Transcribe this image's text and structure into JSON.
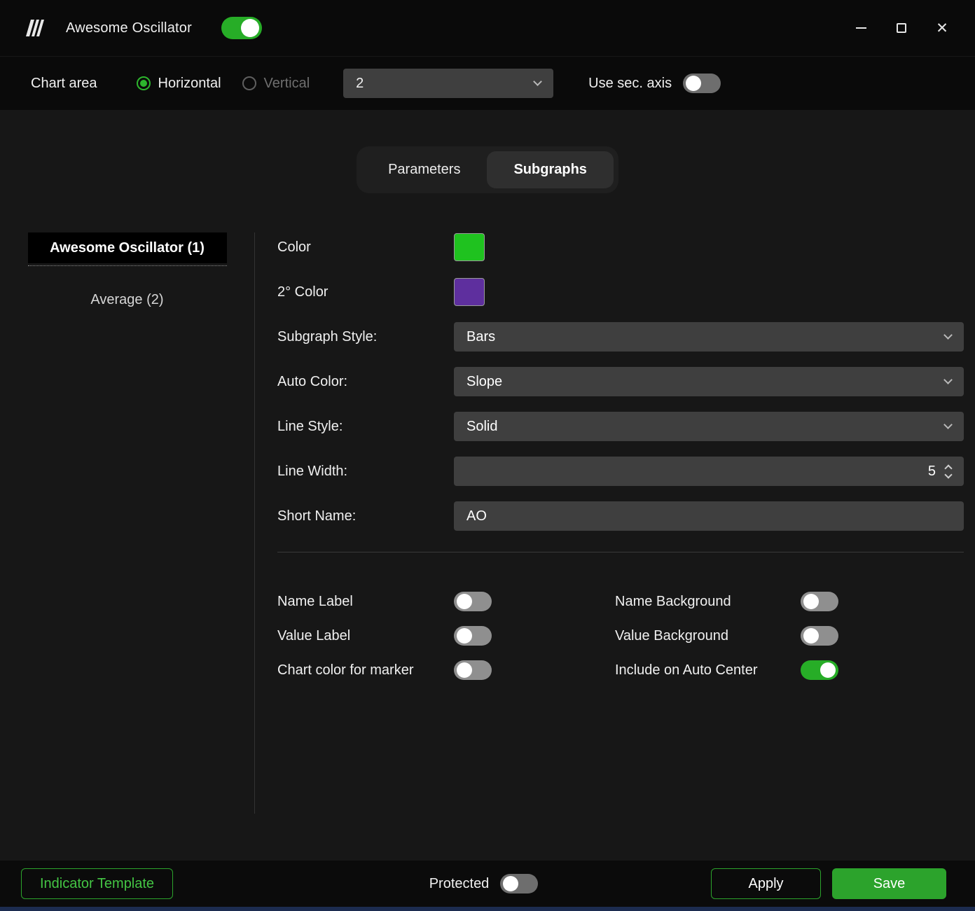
{
  "window": {
    "title": "Awesome Oscillator",
    "enabled": true,
    "close_glyph": "✕"
  },
  "chart_area": {
    "label": "Chart area",
    "options": [
      {
        "label": "Horizontal",
        "selected": true
      },
      {
        "label": "Vertical",
        "selected": false
      }
    ],
    "area_value": "2",
    "sec_axis_label": "Use sec. axis",
    "sec_axis_on": false
  },
  "tabs": [
    {
      "label": "Parameters",
      "active": false
    },
    {
      "label": "Subgraphs",
      "active": true
    }
  ],
  "subgraphs": [
    {
      "label": "Awesome Oscillator (1)",
      "selected": true
    },
    {
      "label": "Average (2)",
      "selected": false
    }
  ],
  "form": {
    "color": {
      "label": "Color",
      "value": "#1fc21f"
    },
    "secondary_color": {
      "label": "2° Color",
      "value": "#5e2f9e"
    },
    "subgraph_style": {
      "label": "Subgraph Style:",
      "value": "Bars"
    },
    "auto_color": {
      "label": "Auto Color:",
      "value": "Slope"
    },
    "line_style": {
      "label": "Line Style:",
      "value": "Solid"
    },
    "line_width": {
      "label": "Line Width:",
      "value": "5"
    },
    "short_name": {
      "label": "Short Name:",
      "value": "AO"
    }
  },
  "display_toggles": {
    "name_label": {
      "label": "Name Label",
      "on": false
    },
    "value_label": {
      "label": "Value Label",
      "on": false
    },
    "chart_color_for_marker": {
      "label": "Chart color for marker",
      "on": false
    },
    "name_background": {
      "label": "Name Background",
      "on": false
    },
    "value_background": {
      "label": "Value Background",
      "on": false
    },
    "include_on_auto_center": {
      "label": "Include on Auto Center",
      "on": true
    }
  },
  "footer": {
    "indicator_template": "Indicator Template",
    "protected": {
      "label": "Protected",
      "on": false
    },
    "apply": "Apply",
    "save": "Save"
  },
  "colors": {
    "accent_green": "#2ca32c",
    "toggle_on_green": "#27ad27",
    "swatch_green": "#1fc21f",
    "swatch_purple": "#5e2f9e"
  },
  "icons": {
    "minimize": "minimize-icon",
    "maximize": "maximize-icon",
    "close": "close-icon",
    "chevron": "chevron-down-icon"
  }
}
